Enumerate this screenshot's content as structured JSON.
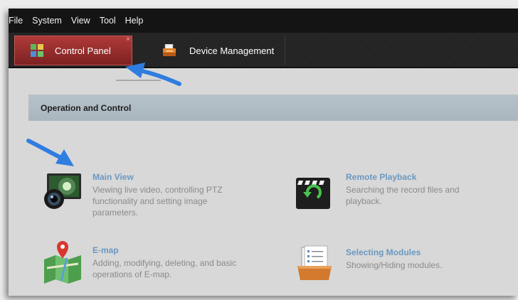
{
  "menu": {
    "items": [
      "File",
      "System",
      "View",
      "Tool",
      "Help"
    ]
  },
  "tabs": [
    {
      "label": "Control Panel",
      "active": true,
      "close": "×"
    },
    {
      "label": "Device Management",
      "active": false
    }
  ],
  "section": {
    "title": "Operation and Control"
  },
  "modules": [
    {
      "title": "Main View",
      "description": "Viewing live video, controlling PTZ functionality and setting image parameters."
    },
    {
      "title": "Remote Playback",
      "description": "Searching the record files and playback."
    },
    {
      "title": "E-map",
      "description": "Adding, modifying, deleting, and basic operations of E-map."
    },
    {
      "title": "Selecting Modules",
      "description": "Showing/Hiding modules."
    }
  ],
  "colors": {
    "menubar": "#141414",
    "active_tab": "#9a2e2e",
    "section_bar": "#b0bcc4",
    "module_title": "#6b98c1",
    "module_desc": "#8a8a8a",
    "annotation_arrow": "#2f7de1"
  }
}
